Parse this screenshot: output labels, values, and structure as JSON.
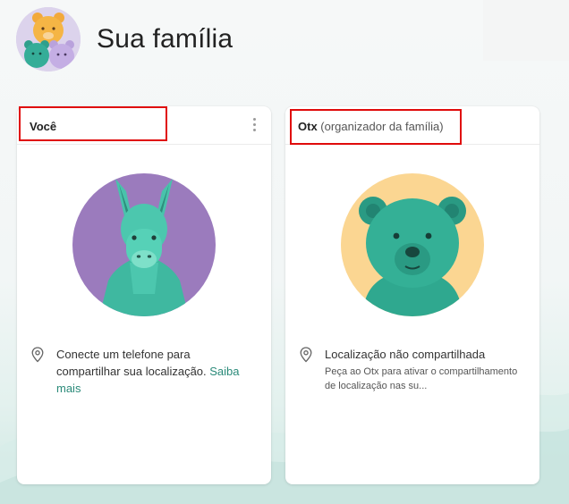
{
  "header": {
    "title": "Sua família",
    "avatar_icon": "family-bears-avatar"
  },
  "members": [
    {
      "name": "Você",
      "role": "",
      "avatar_icon": "llama-avatar",
      "avatar_bg": "#9b7bbd",
      "location_text": "Conecte um telefone para compartilhar sua localização.",
      "location_link": "Saiba mais"
    },
    {
      "name": "Otx",
      "role": "(organizador da família)",
      "avatar_icon": "bear-avatar",
      "avatar_bg": "#fbd692",
      "location_text": "Localização não compartilhada",
      "location_sub": "Peça ao Otx para ativar o compartilhamento de localização nas su..."
    }
  ],
  "colors": {
    "accent": "#2a8a79",
    "highlight": "#e00b0b"
  }
}
